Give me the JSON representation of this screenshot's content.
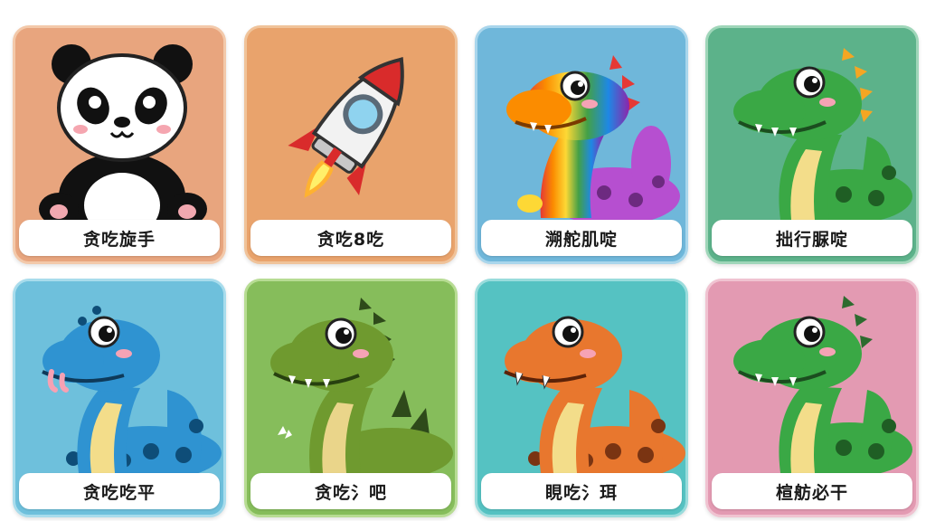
{
  "cards": [
    {
      "label": "贪吃旋手",
      "character": "panda",
      "background": "#e8a57e",
      "border": "#f3c9aa"
    },
    {
      "label": "贪吃8吃",
      "character": "rocket",
      "background": "#e9a36c",
      "border": "#f0c39a"
    },
    {
      "label": "溯舵肌啶",
      "character": "rainbow-dinosaur",
      "background": "#6fb7da",
      "border": "#a9d6ec"
    },
    {
      "label": "拙行脲啶",
      "character": "green-dinosaur",
      "background": "#5cb28a",
      "border": "#9fd6b9"
    },
    {
      "label": "贪吃吃平",
      "character": "blue-snake",
      "background": "#6ec0dc",
      "border": "#a8dcec"
    },
    {
      "label": "贪吃氵吧",
      "character": "green-dinosaur-spiky",
      "background": "#86bd5b",
      "border": "#b7dc93"
    },
    {
      "label": "睍吃氵珥",
      "character": "orange-snake",
      "background": "#55c2c2",
      "border": "#99dcdc"
    },
    {
      "label": "楦舫必干",
      "character": "green-dinosaur",
      "background": "#e39ab2",
      "border": "#f0c3d1"
    }
  ]
}
